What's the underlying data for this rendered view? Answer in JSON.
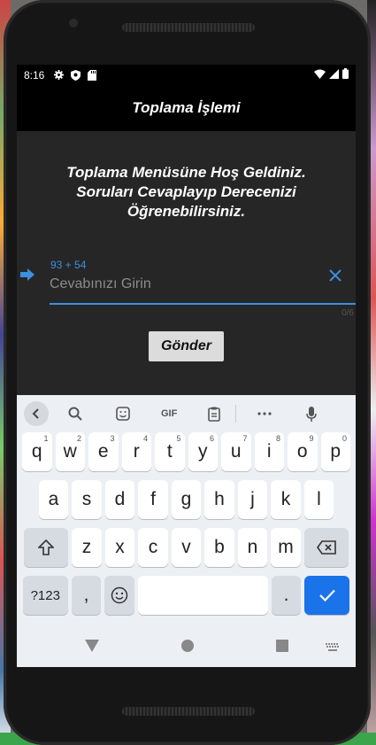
{
  "status": {
    "time": "8:16"
  },
  "appbar": {
    "title": "Toplama İşlemi"
  },
  "welcome": {
    "text": "Toplama Menüsüne Hoş Geldiniz. Soruları Cevaplayıp Derecenizi Öğrenebilirsiniz."
  },
  "form": {
    "question_label": "93 + 54",
    "answer_placeholder": "Cevabınızı Girin",
    "answer_value": "",
    "counter": "0/6",
    "submit_label": "Gönder"
  },
  "keyboard": {
    "toolbar": [
      "back",
      "search",
      "sticker",
      "GIF",
      "clipboard",
      "more",
      "mic"
    ],
    "gif_label": "GIF",
    "row1": [
      {
        "k": "q",
        "h": "1"
      },
      {
        "k": "w",
        "h": "2"
      },
      {
        "k": "e",
        "h": "3"
      },
      {
        "k": "r",
        "h": "4"
      },
      {
        "k": "t",
        "h": "5"
      },
      {
        "k": "y",
        "h": "6"
      },
      {
        "k": "u",
        "h": "7"
      },
      {
        "k": "i",
        "h": "8"
      },
      {
        "k": "o",
        "h": "9"
      },
      {
        "k": "p",
        "h": "0"
      }
    ],
    "row2": [
      "a",
      "s",
      "d",
      "f",
      "g",
      "h",
      "j",
      "k",
      "l"
    ],
    "row3": [
      "z",
      "x",
      "c",
      "v",
      "b",
      "n",
      "m"
    ],
    "symbols_label": "?123",
    "comma_label": ",",
    "period_label": "."
  },
  "colors": {
    "accent": "#3d8fe0",
    "enter": "#1a73e8"
  }
}
